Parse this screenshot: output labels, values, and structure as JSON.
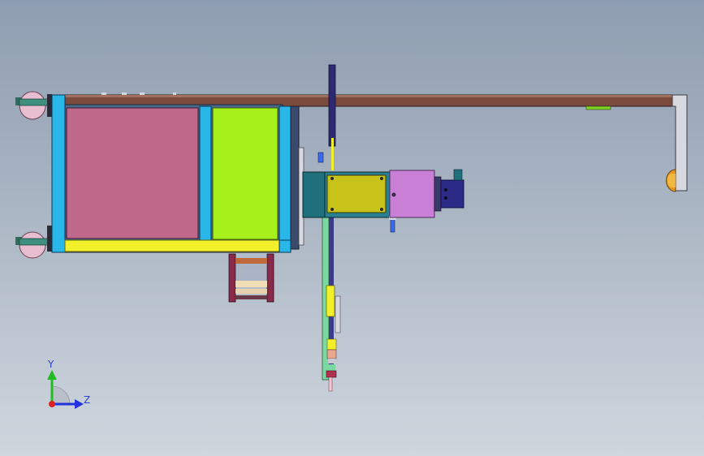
{
  "viewport": {
    "background_top": "#8e9db1",
    "background_bottom": "#cfd6de"
  },
  "triad": {
    "y_label": "Y",
    "z_label": "Z",
    "y_color": "#22bb22",
    "z_color": "#2233dd",
    "x_color": "#dd2222"
  },
  "model": {
    "colors": {
      "bar_brown": "#7a4a3c",
      "frame_cyan": "#29b7ea",
      "panel_pink": "#c0688a",
      "panel_green": "#a6f01c",
      "rail_yellow": "#f2f02a",
      "block_teal": "#1f6f7d",
      "block_olive": "#c8c21a",
      "motor_violet": "#c97fd6",
      "motor_navy": "#2b2a86",
      "shaft_navy": "#2e2a72",
      "bracket_silver": "#d8d8e0",
      "bumper_orange": "#e79a1e",
      "caster_pink": "#e7bfd0",
      "caster_green": "#3f8f7e"
    }
  }
}
